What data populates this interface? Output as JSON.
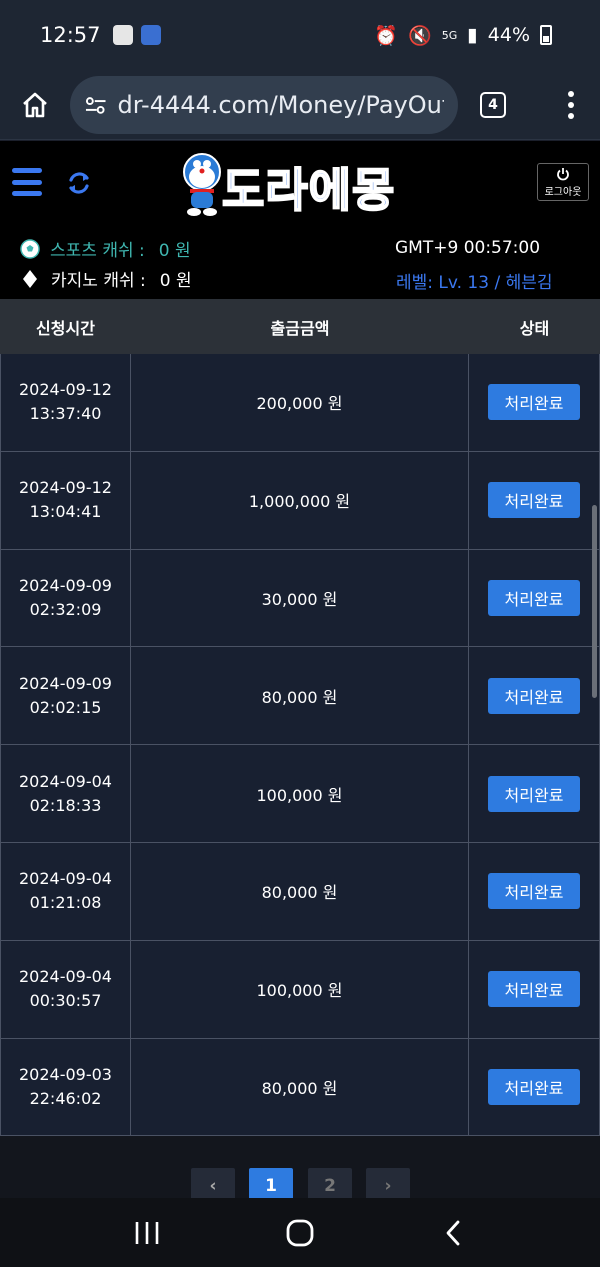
{
  "status_bar": {
    "time": "12:57",
    "battery": "44%",
    "network": "5G"
  },
  "browser": {
    "url": "dr-4444.com/Money/PayOut",
    "tab_count": "4"
  },
  "header": {
    "logo_text": "도라에몽",
    "logout_label": "로그아웃",
    "sports_cash_label": "스포츠 캐쉬 :",
    "sports_cash_value": "0 원",
    "casino_cash_label": "카지노 캐쉬 :",
    "casino_cash_value": "0 원",
    "clock": "GMT+9 00:57:00",
    "level": "레벨: Lv. 13 / 헤븐김"
  },
  "table": {
    "headers": {
      "time": "신청시간",
      "amount": "출금금액",
      "status": "상태"
    },
    "rows": [
      {
        "date": "2024-09-12",
        "time": "13:37:40",
        "amount": "200,000 원",
        "status": "처리완료"
      },
      {
        "date": "2024-09-12",
        "time": "13:04:41",
        "amount": "1,000,000 원",
        "status": "처리완료"
      },
      {
        "date": "2024-09-09",
        "time": "02:32:09",
        "amount": "30,000 원",
        "status": "처리완료"
      },
      {
        "date": "2024-09-09",
        "time": "02:02:15",
        "amount": "80,000 원",
        "status": "처리완료"
      },
      {
        "date": "2024-09-04",
        "time": "02:18:33",
        "amount": "100,000 원",
        "status": "처리완료"
      },
      {
        "date": "2024-09-04",
        "time": "01:21:08",
        "amount": "80,000 원",
        "status": "처리완료"
      },
      {
        "date": "2024-09-04",
        "time": "00:30:57",
        "amount": "100,000 원",
        "status": "처리완료"
      },
      {
        "date": "2024-09-03",
        "time": "22:46:02",
        "amount": "80,000 원",
        "status": "처리완료"
      }
    ]
  },
  "pagination": {
    "prev": "‹",
    "pages": [
      "1",
      "2"
    ],
    "active": "1",
    "next": "›"
  },
  "colors": {
    "accent": "#2e7be0",
    "sports": "#3fb6b0",
    "background": "#182031"
  }
}
